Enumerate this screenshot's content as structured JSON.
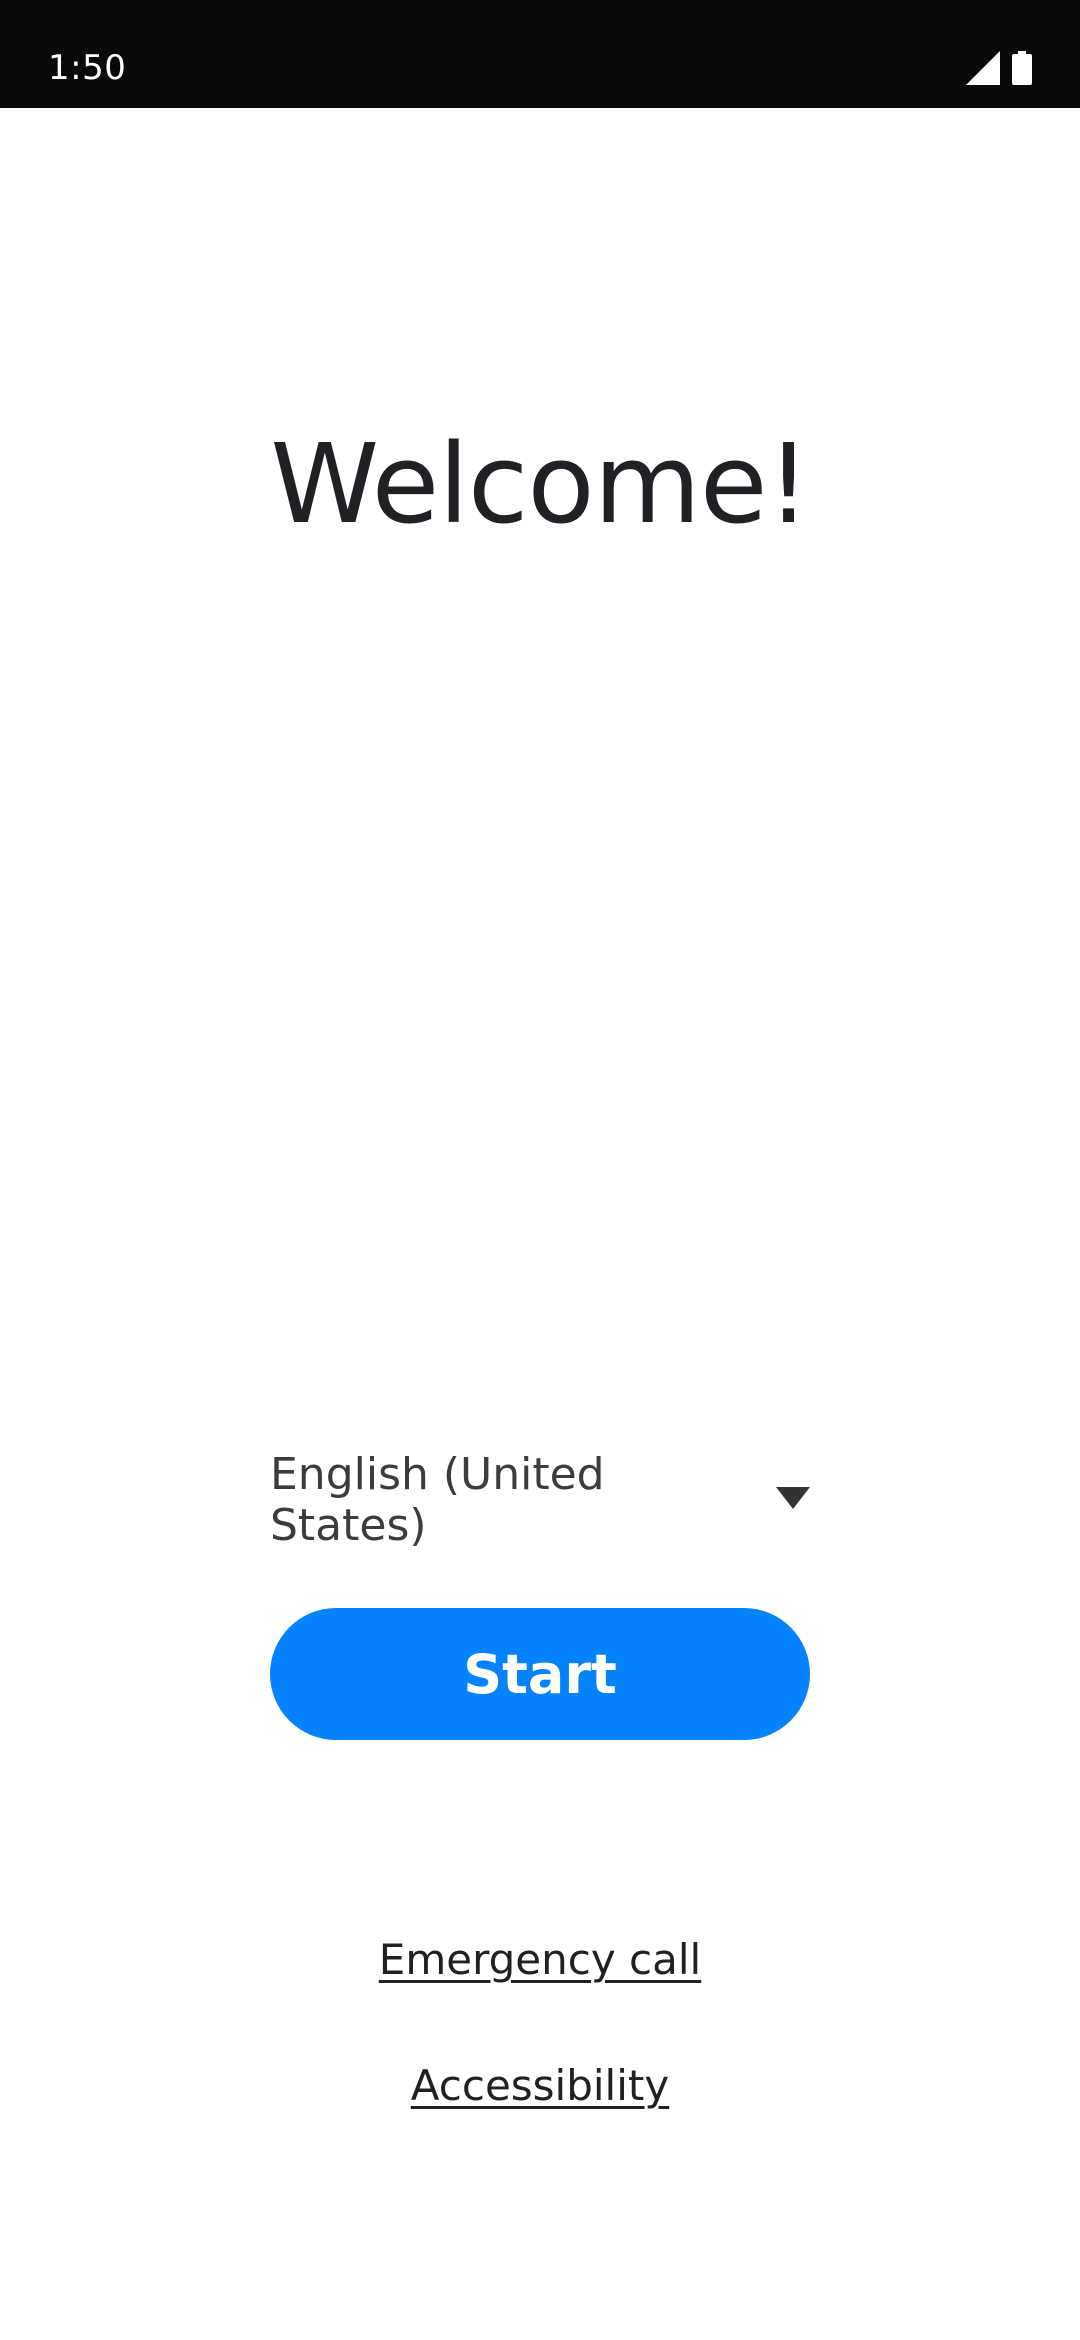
{
  "status_bar": {
    "time": "1:50",
    "icons": [
      "cellular-signal-icon",
      "battery-icon"
    ]
  },
  "welcome": {
    "title": "Welcome!"
  },
  "language": {
    "selected": "English (United States)",
    "icon": "dropdown-arrow-icon"
  },
  "actions": {
    "start_label": "Start",
    "emergency_label": "Emergency call",
    "accessibility_label": "Accessibility"
  },
  "colors": {
    "accent": "#0582fe",
    "status_bar_bg": "#0a0a0c",
    "text_primary": "#202124",
    "text_secondary": "#3c3c3c"
  }
}
